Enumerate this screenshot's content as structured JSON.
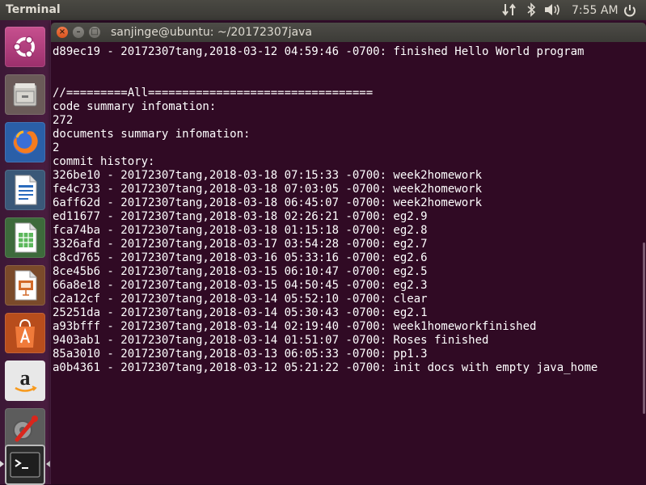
{
  "top_panel": {
    "app_title": "Terminal",
    "clock": "7:55 AM",
    "icons": [
      "network-icon",
      "bluetooth-icon",
      "volume-icon",
      "power-icon"
    ]
  },
  "launcher": {
    "items": [
      {
        "name": "ubuntu-dash",
        "icon": "ubuntu-logo-icon"
      },
      {
        "name": "files",
        "icon": "file-cabinet-icon"
      },
      {
        "name": "firefox",
        "icon": "firefox-icon"
      },
      {
        "name": "libreoffice-writer",
        "icon": "writer-icon"
      },
      {
        "name": "libreoffice-calc",
        "icon": "calc-icon"
      },
      {
        "name": "libreoffice-impress",
        "icon": "impress-icon"
      },
      {
        "name": "ubuntu-software",
        "icon": "software-bag-icon"
      },
      {
        "name": "amazon",
        "icon": "amazon-icon"
      },
      {
        "name": "system-settings",
        "icon": "settings-wrench-icon"
      },
      {
        "name": "terminal",
        "icon": "terminal-icon"
      }
    ]
  },
  "window": {
    "title": "sanjinge@ubuntu: ~/20172307java"
  },
  "terminal": {
    "lines": [
      "d89ec19 - 20172307tang,2018-03-12 04:59:46 -0700: finished Hello World program",
      "",
      "",
      "//=========All=================================",
      "code summary infomation:",
      "272",
      "documents summary infomation:",
      "2",
      "commit history:",
      "326be10 - 20172307tang,2018-03-18 07:15:33 -0700: week2homework",
      "fe4c733 - 20172307tang,2018-03-18 07:03:05 -0700: week2homework",
      "6aff62d - 20172307tang,2018-03-18 06:45:07 -0700: week2homework",
      "ed11677 - 20172307tang,2018-03-18 02:26:21 -0700: eg2.9",
      "fca74ba - 20172307tang,2018-03-18 01:15:18 -0700: eg2.8",
      "3326afd - 20172307tang,2018-03-17 03:54:28 -0700: eg2.7",
      "c8cd765 - 20172307tang,2018-03-16 05:33:16 -0700: eg2.6",
      "8ce45b6 - 20172307tang,2018-03-15 06:10:47 -0700: eg2.5",
      "66a8e18 - 20172307tang,2018-03-15 04:50:45 -0700: eg2.3",
      "c2a12cf - 20172307tang,2018-03-14 05:52:10 -0700: clear",
      "25251da - 20172307tang,2018-03-14 05:30:43 -0700: eg2.1",
      "a93bfff - 20172307tang,2018-03-14 02:19:40 -0700: week1homeworkfinished",
      "9403ab1 - 20172307tang,2018-03-14 01:51:07 -0700: Roses finished",
      "85a3010 - 20172307tang,2018-03-13 06:05:33 -0700: pp1.3",
      "a0b4361 - 20172307tang,2018-03-12 05:21:22 -0700: init docs with empty java_home"
    ]
  },
  "colors": {
    "terminal_bg": "#300a24",
    "close_button": "#e95420",
    "panel_bg": "#3c3b37"
  }
}
